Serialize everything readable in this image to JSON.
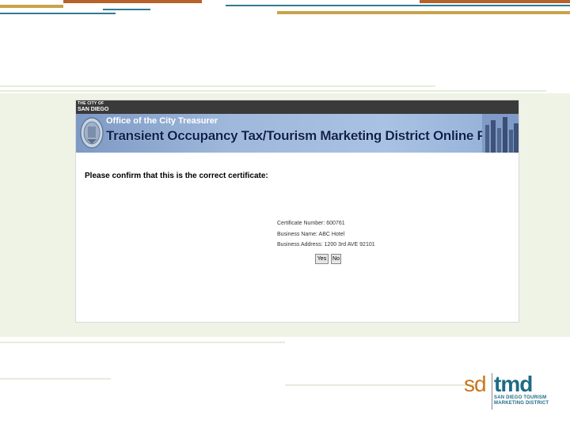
{
  "header": {
    "city_line1": "THE CITY OF",
    "city_line2": "SAN DIEGO",
    "office": "Office of the City Treasurer",
    "title": "Transient Occupancy Tax/Tourism Marketing District Online Payment"
  },
  "main": {
    "prompt": "Please confirm that this is the correct certificate:",
    "certificate_number": "Certificate Number: 600761",
    "business_name": "Business Name: ABC Hotel",
    "business_address": "Business Address: 1200 3rd AVE 92101",
    "yes_label": "Yes",
    "no_label": "No"
  },
  "logo": {
    "sd": "sd",
    "tmd": "tmd",
    "sub_line1": "SAN DIEGO TOURISM",
    "sub_line2": "MARKETING DISTRICT"
  },
  "colors": {
    "accent_orange": "#c8761f",
    "accent_teal": "#1e6b85",
    "banner_blue": "#9fb8db",
    "title_navy": "#0d1f4d"
  }
}
